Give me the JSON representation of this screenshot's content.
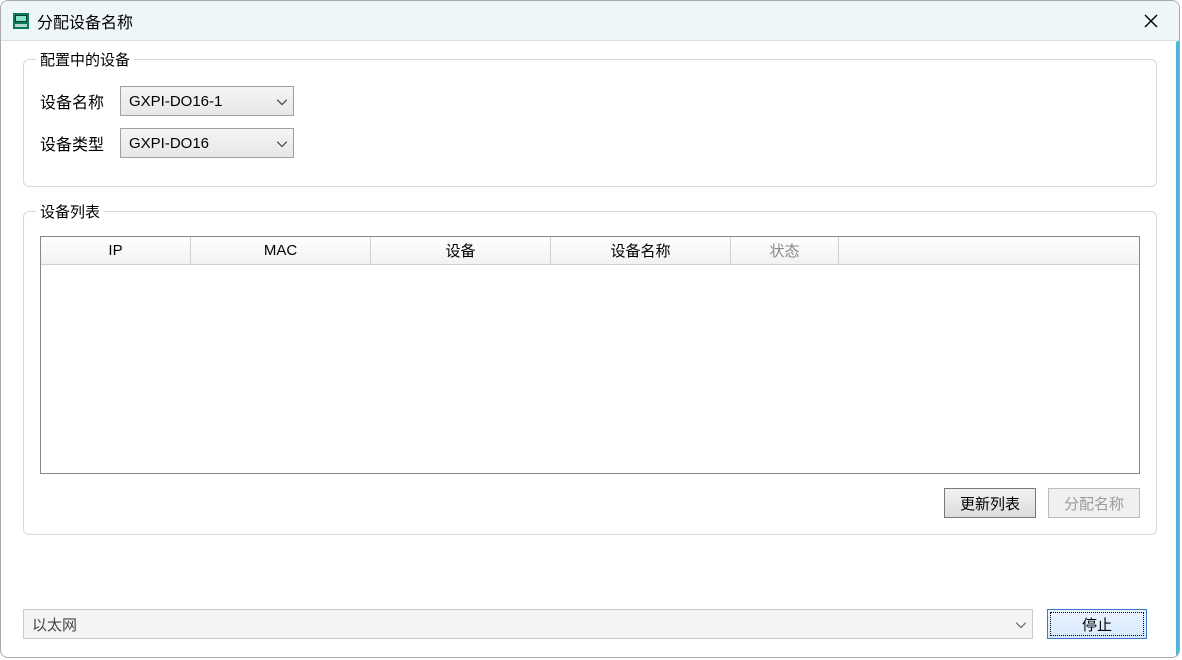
{
  "window": {
    "title": "分配设备名称"
  },
  "config_group": {
    "legend": "配置中的设备",
    "device_name_label": "设备名称",
    "device_name_value": "GXPI-DO16-1",
    "device_type_label": "设备类型",
    "device_type_value": "GXPI-DO16"
  },
  "list_group": {
    "legend": "设备列表",
    "columns": {
      "ip": "IP",
      "mac": "MAC",
      "device": "设备",
      "device_name": "设备名称",
      "status": "状态"
    },
    "rows": []
  },
  "buttons": {
    "refresh": "更新列表",
    "assign": "分配名称",
    "stop": "停止"
  },
  "bottom": {
    "interface_value": "以太网"
  }
}
